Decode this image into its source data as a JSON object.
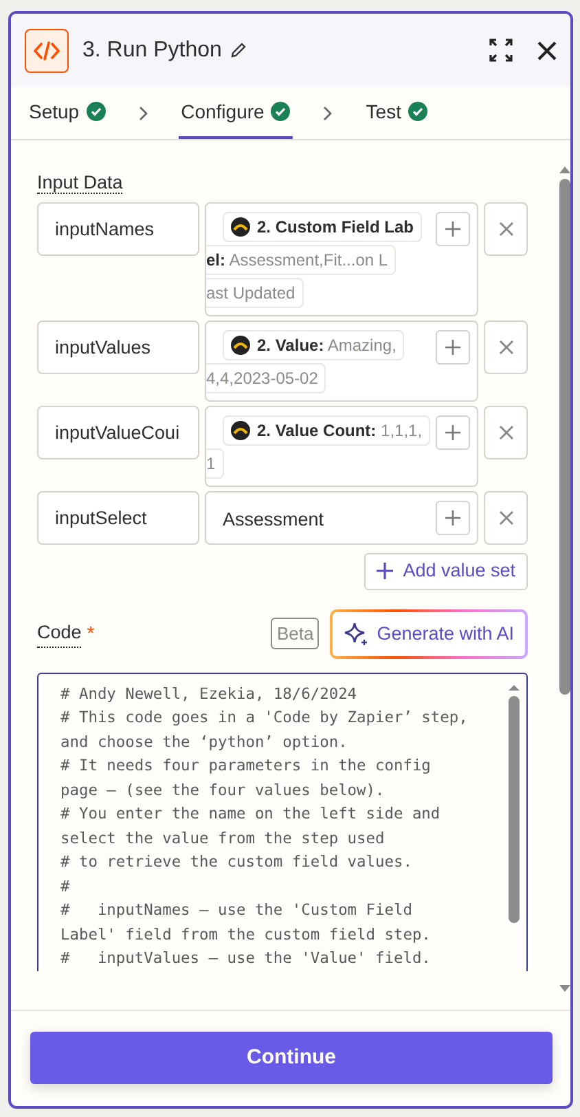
{
  "header": {
    "title": "3. Run Python"
  },
  "steps": [
    {
      "label": "Setup",
      "selected": false,
      "done": true
    },
    {
      "label": "Configure",
      "selected": true,
      "done": true
    },
    {
      "label": "Test",
      "selected": false,
      "done": true
    }
  ],
  "input_data": {
    "label": "Input Data",
    "rows": [
      {
        "name": "inputNames",
        "value": {
          "kind": "pill",
          "lines": [
            {
              "bold": "2. Custom Field Lab"
            },
            {
              "bold": "el:",
              "text": "Assessment,Fit...on L"
            },
            {
              "text": "ast Updated"
            }
          ]
        }
      },
      {
        "name": "inputValues",
        "value": {
          "kind": "pill",
          "lines": [
            {
              "bold": "2. Value:",
              "text": "Amazing,"
            },
            {
              "text": "4,4,2023-05-02"
            }
          ]
        }
      },
      {
        "name": "inputValueCoui",
        "value": {
          "kind": "pill",
          "lines": [
            {
              "bold": "2. Value Count:",
              "text": "1,1,1,"
            },
            {
              "text": "1"
            }
          ]
        }
      },
      {
        "name": "inputSelect",
        "value": {
          "kind": "text",
          "text": "Assessment"
        }
      }
    ],
    "add_label": "Add value set"
  },
  "code": {
    "label": "Code",
    "required": "*",
    "badge": "Beta",
    "ai_button": "Generate with AI",
    "lines": [
      "# Andy Newell, Ezekia, 18/6/2024",
      "# This code goes in a 'Code by Zapier’ step,",
      "and choose the ‘python’ option.",
      "# It needs four parameters in the config",
      "page – (see the four values below).",
      "# You enter the name on the left side and",
      "select the value from the step used",
      "# to retrieve the custom field values.",
      "#",
      "#   inputNames – use the 'Custom Field",
      "Label' field from the custom field step.",
      "#   inputValues – use the 'Value' field."
    ]
  },
  "footer": {
    "button": "Continue"
  }
}
